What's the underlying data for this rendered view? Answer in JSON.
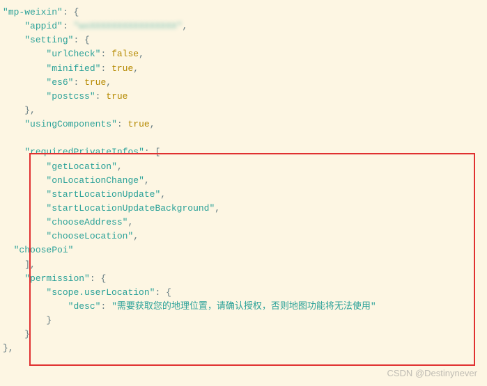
{
  "code": {
    "rootKey": "mp-weixin",
    "appidKey": "appid",
    "appidValue": "wxXXXXXXXXXXXXXXXX",
    "settingKey": "setting",
    "urlCheckKey": "urlCheck",
    "urlCheckValue": "false",
    "minifiedKey": "minified",
    "minifiedValue": "true",
    "es6Key": "es6",
    "es6Value": "true",
    "postcssKey": "postcss",
    "postcssValue": "true",
    "usingComponentsKey": "usingComponents",
    "usingComponentsValue": "true",
    "requiredPrivateInfosKey": "requiredPrivateInfos",
    "rpi": [
      "getLocation",
      "onLocationChange",
      "startLocationUpdate",
      "startLocationUpdateBackground",
      "chooseAddress",
      "chooseLocation",
      "choosePoi"
    ],
    "permissionKey": "permission",
    "scopeKey": "scope.userLocation",
    "descKey": "desc",
    "descValue": "需要获取您的地理位置，请确认授权，否则地图功能将无法使用"
  },
  "watermark": "CSDN @Destinynever"
}
